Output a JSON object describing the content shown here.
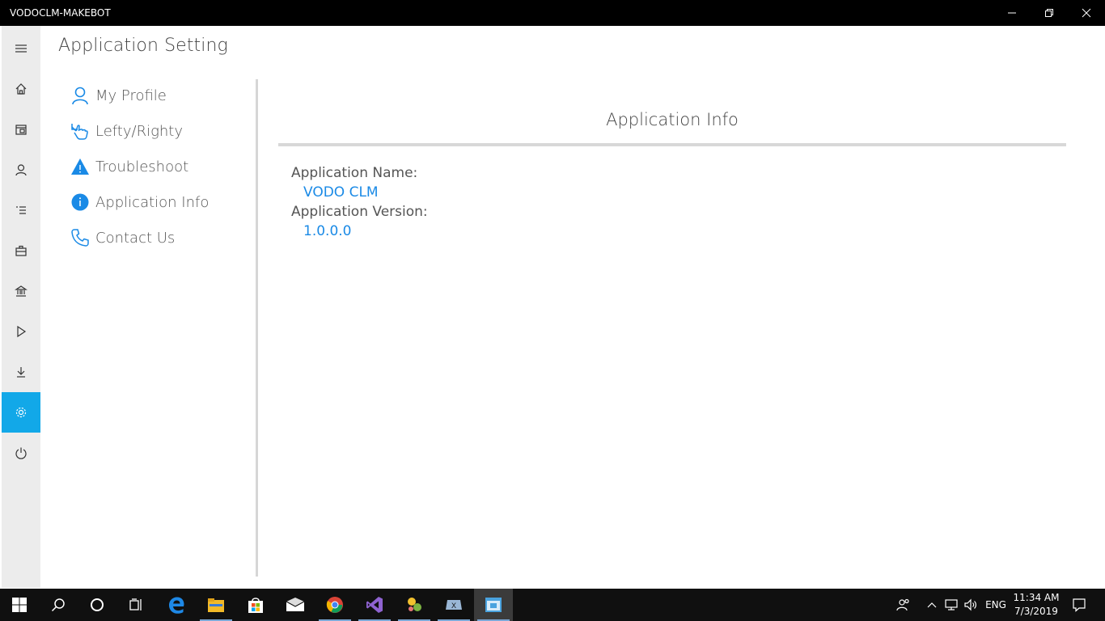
{
  "window": {
    "title": "VODOCLM-MAKEBOT"
  },
  "page": {
    "title": "Application Setting"
  },
  "rail": {
    "items": [
      {
        "icon": "hamburger-menu-icon"
      },
      {
        "icon": "home-icon"
      },
      {
        "icon": "store-icon"
      },
      {
        "icon": "person-icon"
      },
      {
        "icon": "list-icon"
      },
      {
        "icon": "briefcase-icon"
      },
      {
        "icon": "bank-icon"
      },
      {
        "icon": "play-icon"
      },
      {
        "icon": "download-icon"
      },
      {
        "icon": "gear-icon",
        "active": true
      },
      {
        "icon": "power-icon"
      }
    ],
    "active_color": "#12a8e8"
  },
  "settings_menu": {
    "items": [
      {
        "label": "My Profile",
        "icon": "person-icon"
      },
      {
        "label": "Lefty/Righty",
        "icon": "hand-pointer-icon"
      },
      {
        "label": "Troubleshoot",
        "icon": "warning-icon"
      },
      {
        "label": "Application Info",
        "icon": "info-icon"
      },
      {
        "label": "Contact Us",
        "icon": "phone-icon"
      }
    ],
    "accent": "#1a8ae6"
  },
  "content": {
    "title": "Application Info",
    "name_label": "Application Name:",
    "name_value": "VODO CLM",
    "version_label": "Application Version:",
    "version_value": "1.0.0.0"
  },
  "taskbar": {
    "apps": [
      "windows-start-icon",
      "search-icon",
      "cortana-icon",
      "task-view-icon",
      "edge-icon",
      "file-explorer-icon",
      "store-icon",
      "mail-icon",
      "chrome-icon",
      "visual-studio-icon",
      "app-icon",
      "app-icon-2",
      "active-app-icon"
    ],
    "language": "ENG",
    "time": "11:34 AM",
    "date": "7/3/2019"
  }
}
